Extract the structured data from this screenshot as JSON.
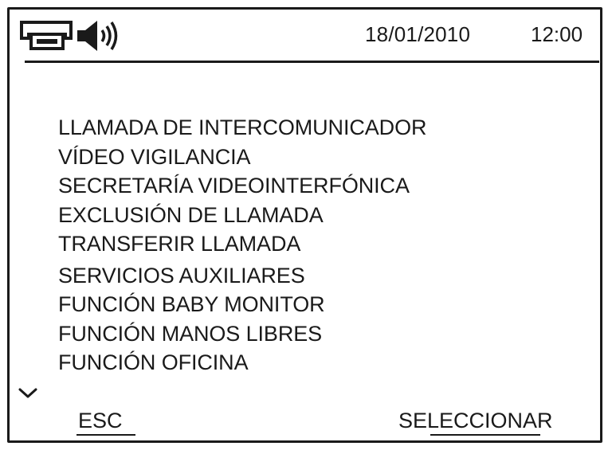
{
  "status_bar": {
    "icons": [
      "intercom-handset-icon",
      "speaker-volume-icon"
    ],
    "date": "18/01/2010",
    "time": "12:00"
  },
  "menu": {
    "items": [
      {
        "label": "LLAMADA DE INTERCOMUNICADOR"
      },
      {
        "label": "VÍDEO VIGILANCIA"
      },
      {
        "label": "SECRETARÍA VIDEOINTERFÓNICA"
      },
      {
        "label": "EXCLUSIÓN DE LLAMADA"
      },
      {
        "label": "TRANSFERIR LLAMADA"
      },
      {
        "label": "SERVICIOS AUXILIARES"
      },
      {
        "label": "FUNCIÓN BABY MONITOR"
      },
      {
        "label": "FUNCIÓN MANOS LIBRES"
      },
      {
        "label": "FUNCIÓN OFICINA"
      }
    ],
    "more_indicator_icon": "chevron-down-icon"
  },
  "softkeys": {
    "left_label": "ESC",
    "right_label": "SELECCIONAR"
  }
}
